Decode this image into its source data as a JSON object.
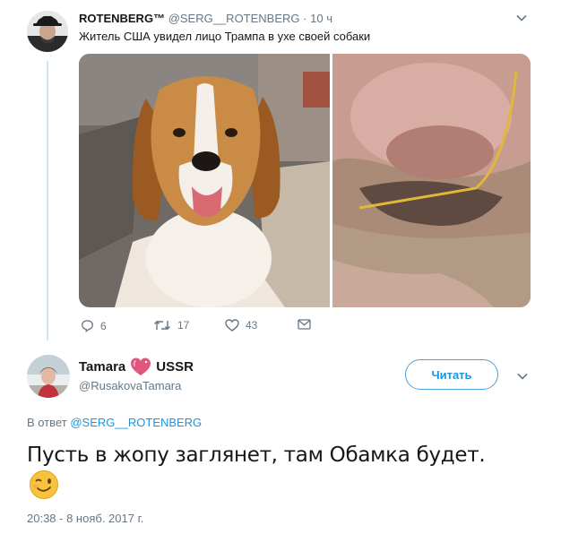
{
  "parent_tweet": {
    "name": "ROTENBERG™",
    "handle": "@SERG__ROTENBERG",
    "separator": "·",
    "time": "10 ч",
    "text": "Житель США увидел лицо Трампа в ухе своей собаки",
    "actions": {
      "replies": "6",
      "retweets": "17",
      "likes": "43"
    },
    "menu_icon": "chevron-down-icon"
  },
  "reply_tweet": {
    "name_first": "Tamara",
    "name_last": "USSR",
    "name_emoji": "sparkling-heart-icon",
    "handle": "@RusakovaTamara",
    "follow_label": "Читать",
    "reply_prefix": "В ответ",
    "reply_mention": "@SERG__ROTENBERG",
    "text": "Пусть в жопу заглянет, там Обамка будет.",
    "emoji": "winking-face-icon",
    "timestamp": "20:38 - 8 нояб. 2017 г."
  },
  "colors": {
    "link": "#1b95e0",
    "muted": "#657786",
    "text": "#14171a",
    "thread_line": "#cfe3f5"
  }
}
